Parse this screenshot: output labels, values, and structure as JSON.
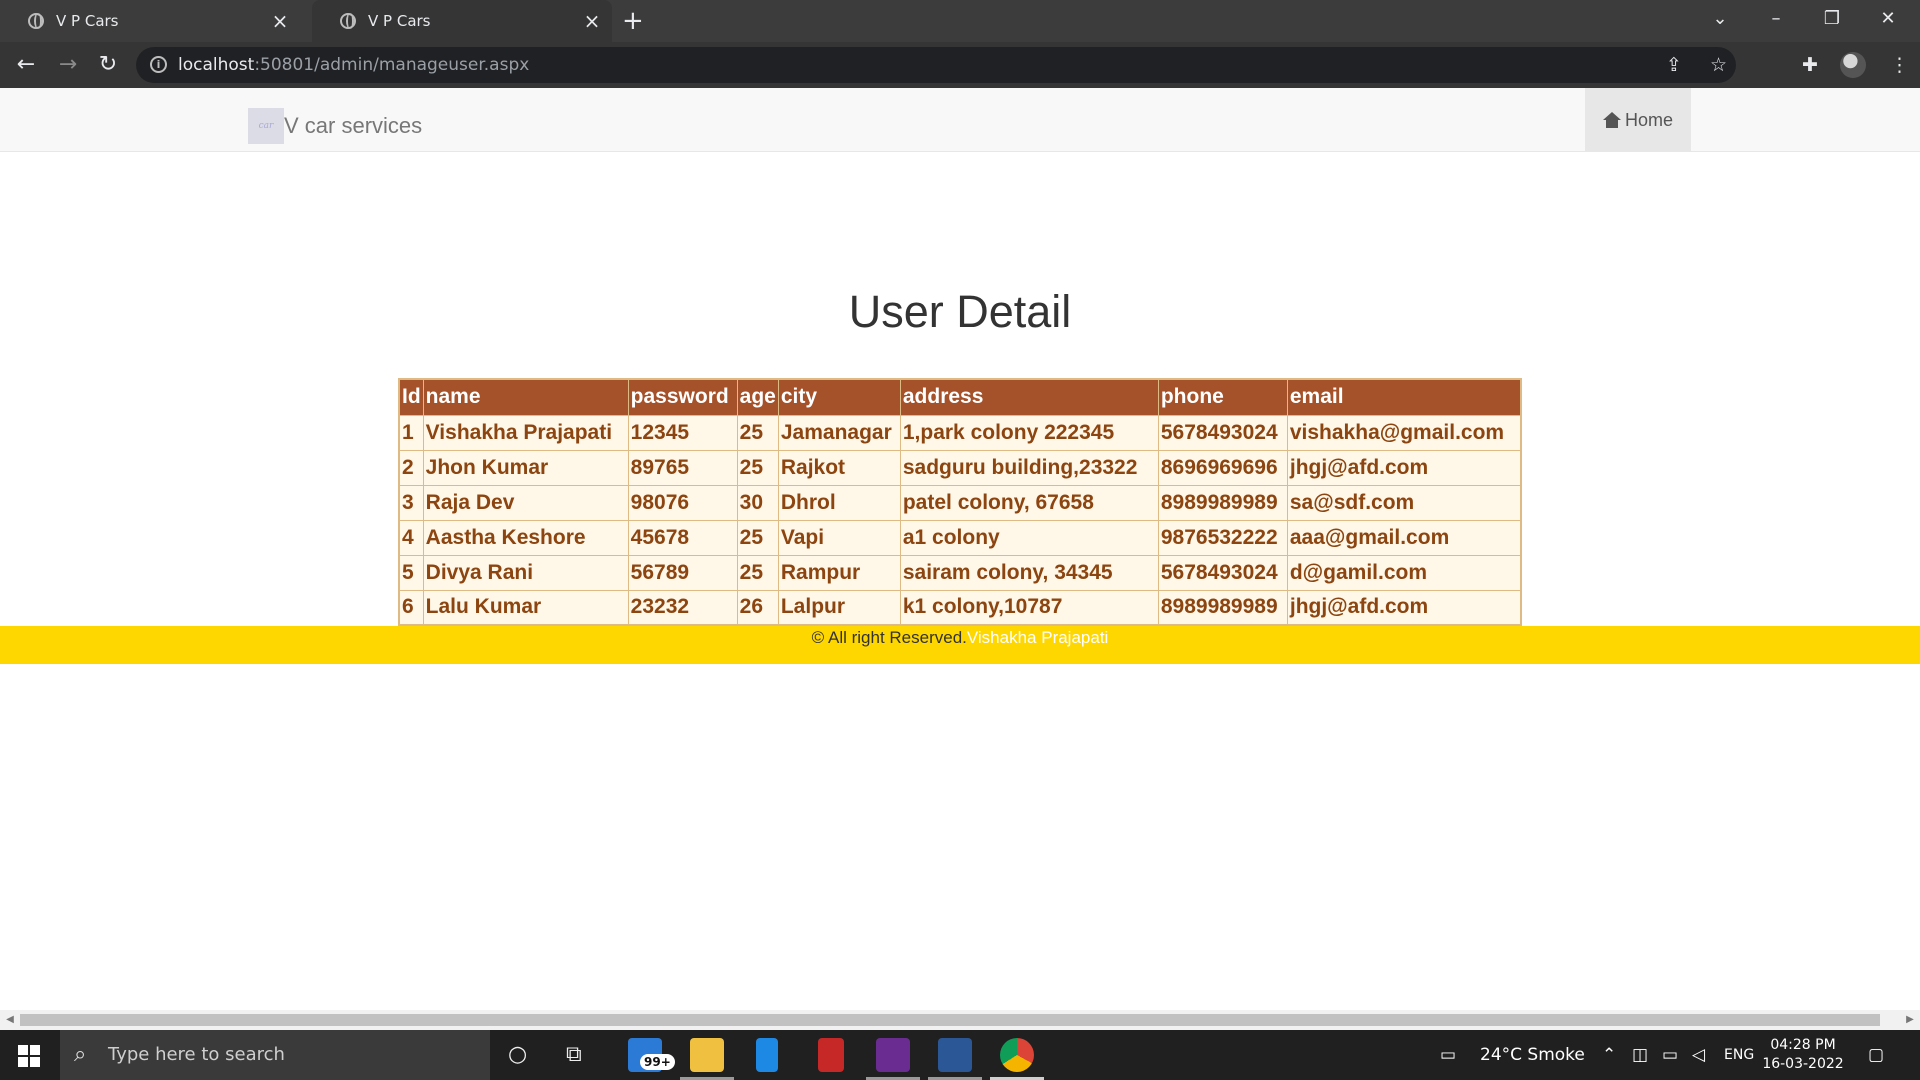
{
  "browser": {
    "tabs": [
      {
        "title": "V P Cars"
      },
      {
        "title": "V P Cars"
      }
    ],
    "new_tab": "+",
    "url_host": "localhost",
    "url_path": ":50801/admin/manageuser.aspx"
  },
  "site": {
    "brand": "V car services",
    "nav_home": "Home"
  },
  "page": {
    "title": "User Detail",
    "table": {
      "columns": [
        "Id",
        "name",
        "password",
        "age",
        "city",
        "address",
        "phone",
        "email"
      ],
      "rows": [
        [
          "1",
          "Vishakha Prajapati",
          "12345",
          "25",
          "Jamanagar",
          "1,park colony 222345",
          "5678493024",
          "vishakha@gmail.com"
        ],
        [
          "2",
          "Jhon Kumar",
          "89765",
          "25",
          "Rajkot",
          "sadguru building,23322",
          "8696969696",
          "jhgj@afd.com"
        ],
        [
          "3",
          "Raja Dev",
          "98076",
          "30",
          "Dhrol",
          "patel colony, 67658",
          "8989989989",
          "sa@sdf.com"
        ],
        [
          "4",
          "Aastha Keshore",
          "45678",
          "25",
          "Vapi",
          "a1 colony",
          "9876532222",
          "aaa@gmail.com"
        ],
        [
          "5",
          "Divya Rani",
          "56789",
          "25",
          "Rampur",
          "sairam colony, 34345",
          "5678493024",
          "d@gamil.com"
        ],
        [
          "6",
          "Lalu Kumar",
          "23232",
          "26",
          "Lalpur",
          "k1 colony,10787",
          "8989989989",
          "jhgj@afd.com"
        ]
      ]
    },
    "footer": {
      "text": "© All right Reserved.",
      "author": "Vishakha Prajapati"
    }
  },
  "taskbar": {
    "search_placeholder": "Type here to search",
    "mail_badge": "99+",
    "weather": "24°C  Smoke",
    "language": "ENG",
    "time": "04:28 PM",
    "date": "16-03-2022"
  },
  "colors": {
    "header_bg": "#a55129",
    "row_bg": "#fff7e7",
    "row_text": "#8c4510",
    "footer_bg": "#ffd700"
  }
}
